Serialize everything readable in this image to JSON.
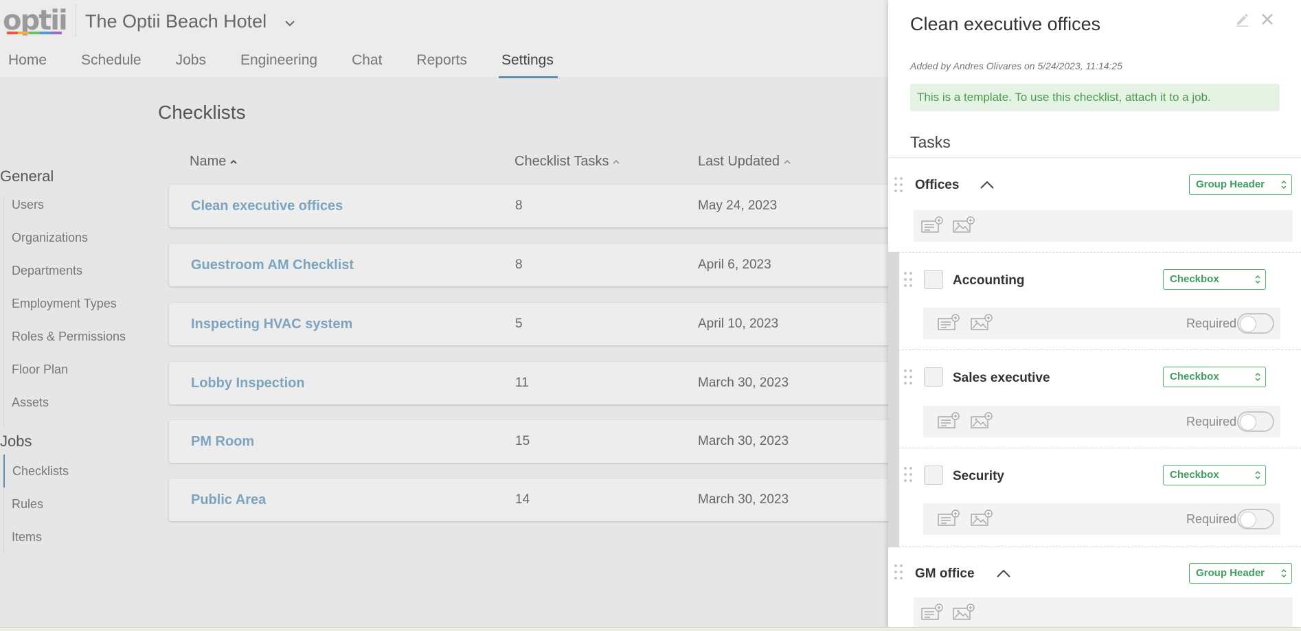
{
  "header": {
    "logo_text": "optii",
    "logo_colors": [
      "#e05a4f",
      "#f0b23c",
      "#6cbf6a",
      "#4d9bd6",
      "#9a6cd0"
    ],
    "hotel_name": "The Optii Beach Hotel",
    "nav": [
      {
        "label": "Home"
      },
      {
        "label": "Schedule"
      },
      {
        "label": "Jobs"
      },
      {
        "label": "Engineering"
      },
      {
        "label": "Chat"
      },
      {
        "label": "Reports"
      },
      {
        "label": "Settings",
        "active": true
      }
    ]
  },
  "page": {
    "title": "Checklists"
  },
  "sidebar": {
    "general_title": "General",
    "general_items": [
      {
        "label": "Users"
      },
      {
        "label": "Organizations"
      },
      {
        "label": "Departments"
      },
      {
        "label": "Employment Types"
      },
      {
        "label": "Roles & Permissions"
      },
      {
        "label": "Floor Plan"
      },
      {
        "label": "Assets"
      }
    ],
    "jobs_title": "Jobs",
    "jobs_items": [
      {
        "label": "Checklists",
        "active": true
      },
      {
        "label": "Rules"
      },
      {
        "label": "Items"
      }
    ]
  },
  "table": {
    "columns": [
      "Name",
      "Checklist Tasks",
      "Last Updated"
    ],
    "rows": [
      {
        "name": "Clean executive offices",
        "tasks": "8",
        "updated": "May 24, 2023"
      },
      {
        "name": "Guestroom AM Checklist",
        "tasks": "8",
        "updated": "April 6, 2023"
      },
      {
        "name": "Inspecting HVAC system",
        "tasks": "5",
        "updated": "April 10, 2023"
      },
      {
        "name": "Lobby Inspection",
        "tasks": "11",
        "updated": "March 30, 2023"
      },
      {
        "name": "PM Room",
        "tasks": "15",
        "updated": "March 30, 2023"
      },
      {
        "name": "Public Area",
        "tasks": "14",
        "updated": "March 30, 2023"
      }
    ]
  },
  "drawer": {
    "title": "Clean executive offices",
    "added_by": "Added by Andres Olivares on 5/24/2023, 11:14:25",
    "template_note": "This is a template. To use this checklist, attach it to a job.",
    "tasks_title": "Tasks",
    "groups": [
      {
        "title": "Offices",
        "type": "Group Header"
      },
      {
        "title": "GM office",
        "type": "Group Header"
      }
    ],
    "tasks": [
      {
        "label": "Accounting",
        "type": "Checkbox",
        "required_label": "Required"
      },
      {
        "label": "Sales executive",
        "type": "Checkbox",
        "required_label": "Required"
      },
      {
        "label": "Security",
        "type": "Checkbox",
        "required_label": "Required"
      }
    ]
  }
}
